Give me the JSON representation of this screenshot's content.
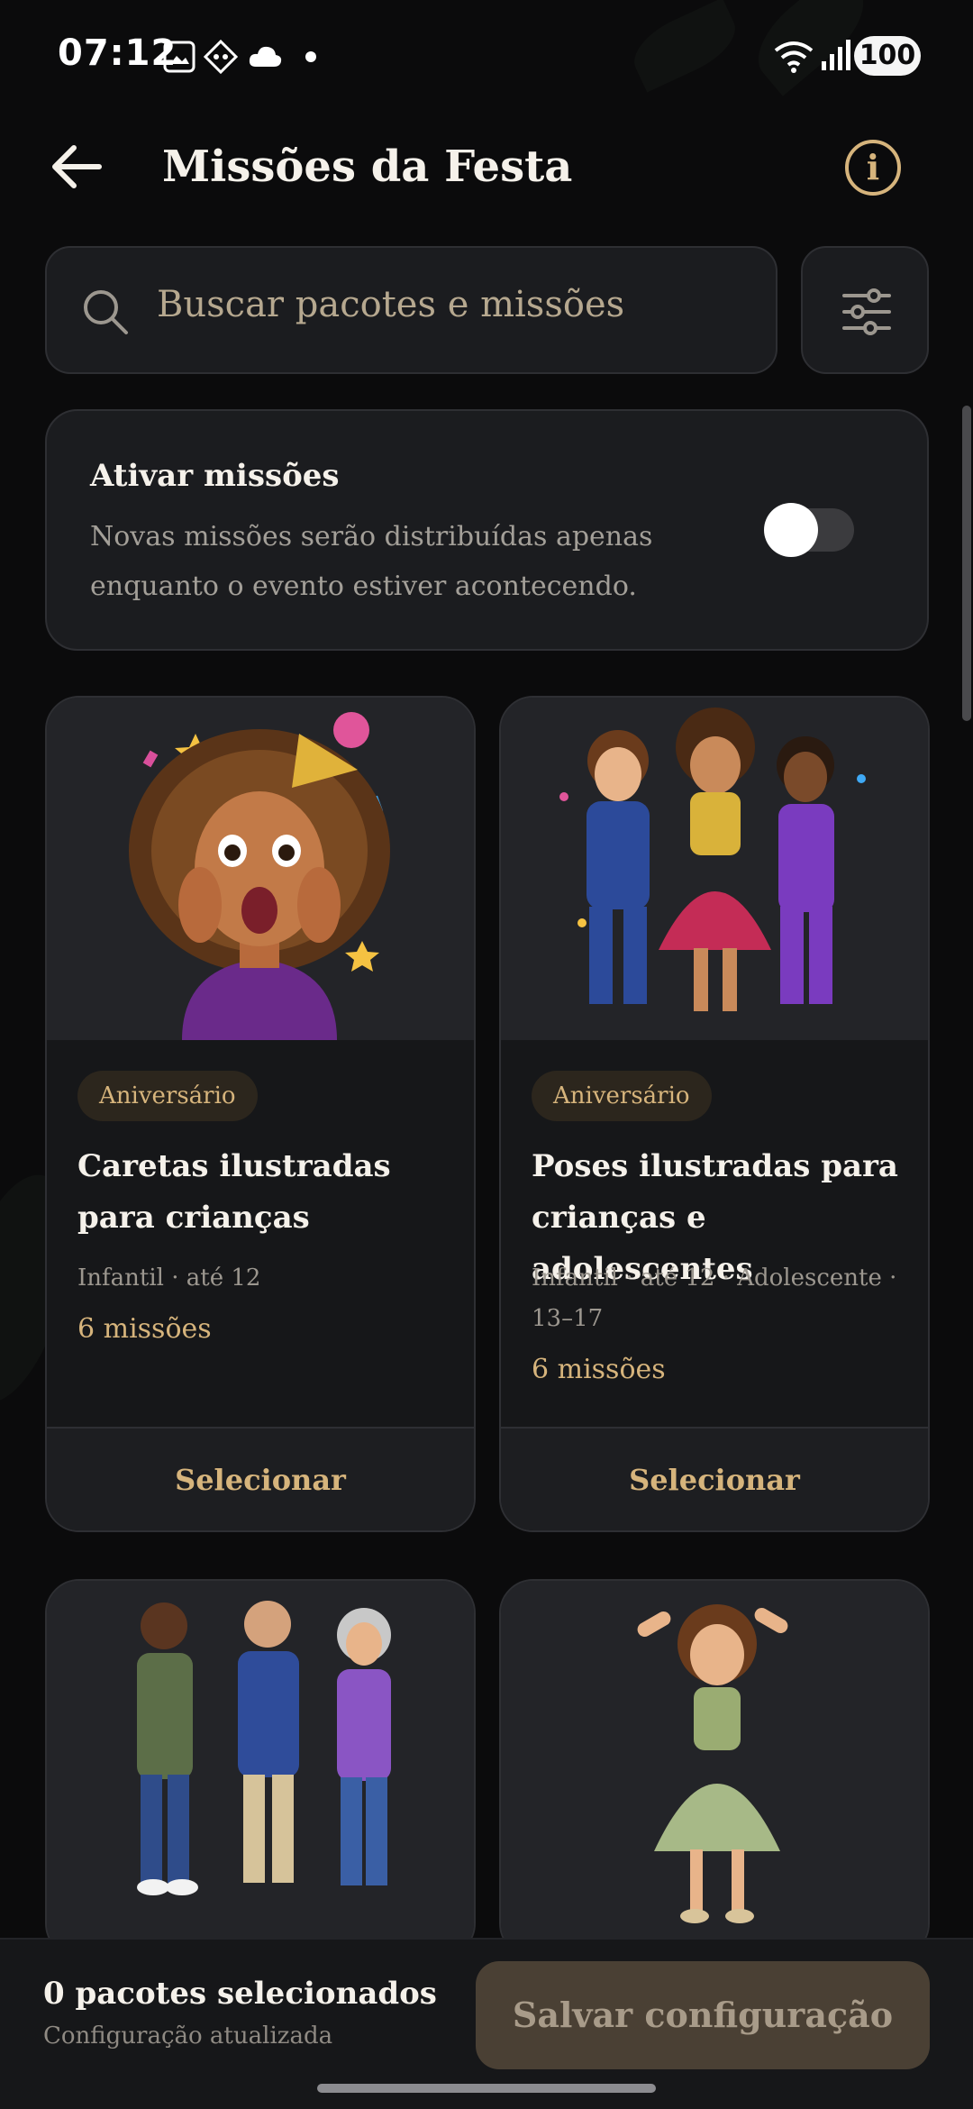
{
  "status_bar": {
    "time": "07:12",
    "left_icons": [
      "screenshot-icon",
      "diamond-app-icon",
      "cloud-icon",
      "dot-icon"
    ],
    "right_icons": [
      "wifi-icon",
      "signal-icon"
    ],
    "battery": "100"
  },
  "header": {
    "title": "Missões da Festa",
    "back_icon": "arrow-left-icon",
    "info_icon": "info-icon",
    "info_glyph": "i"
  },
  "search": {
    "placeholder": "Buscar pacotes e missões",
    "filter_icon": "sliders-icon"
  },
  "toggle_card": {
    "title": "Ativar missões",
    "description": "Novas missões serão distribuídas apenas enquanto o evento estiver acontecendo.",
    "enabled": false
  },
  "packages": [
    {
      "badge": "Aniversário",
      "title": "Caretas ilustradas para crianças",
      "meta": "Infantil · até 12",
      "count": "6 missões",
      "action": "Selecionar",
      "image": "surprised-girl-party-hat-illustration"
    },
    {
      "badge": "Aniversário",
      "title": "Poses ilustradas para crianças e adolescentes",
      "meta": "Infantil · até 12 · Adolescente · 13–17",
      "count": "6 missões",
      "action": "Selecionar",
      "image": "three-kids-posing-illustration"
    },
    {
      "image": "three-adults-chatting-illustration"
    },
    {
      "image": "girl-green-dress-posing-illustration"
    }
  ],
  "bottom_bar": {
    "selected_count": "0 pacotes selecionados",
    "status": "Configuração atualizada",
    "save_label": "Salvar configuração"
  },
  "colors": {
    "background": "#0b0b0c",
    "card": "#1b1c1f",
    "accent": "#d6b47c",
    "save_button": "#4a4034"
  }
}
